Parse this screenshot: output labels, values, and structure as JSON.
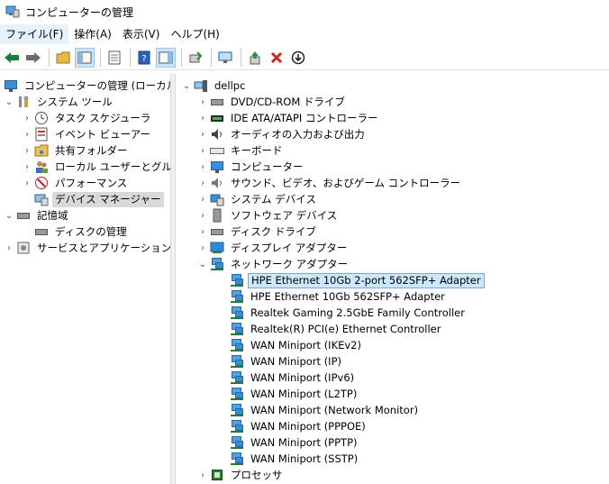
{
  "window": {
    "title": "コンピューターの管理"
  },
  "menu": [
    {
      "label": "ファイル(F)"
    },
    {
      "label": "操作(A)"
    },
    {
      "label": "表示(V)"
    },
    {
      "label": "ヘルプ(H)"
    }
  ],
  "left_tree": {
    "root": "コンピューターの管理 (ローカル)",
    "system_tools": "システム ツール",
    "task_scheduler": "タスク スケジューラ",
    "event_viewer": "イベント ビューアー",
    "shared_folders": "共有フォルダー",
    "local_users": "ローカル ユーザーとグループ",
    "performance": "パフォーマンス",
    "device_manager": "デバイス マネージャー",
    "storage": "記憶域",
    "disk_management": "ディスクの管理",
    "services_apps": "サービスとアプリケーション"
  },
  "device_tree": {
    "computer_name": "dellpc",
    "categories": {
      "dvd": "DVD/CD-ROM ドライブ",
      "ide": "IDE ATA/ATAPI コントローラー",
      "audio_io": "オーディオの入力および出力",
      "keyboard": "キーボード",
      "computer": "コンピューター",
      "sound": "サウンド、ビデオ、およびゲーム コントローラー",
      "system_devices": "システム デバイス",
      "software_devices": "ソフトウェア デバイス",
      "disk_drives": "ディスク ドライブ",
      "display_adapters": "ディスプレイ アダプター",
      "network_adapters": "ネットワーク アダプター",
      "processors": "プロセッサ"
    },
    "network_devices": [
      "HPE Ethernet 10Gb 2-port 562SFP+ Adapter",
      "HPE Ethernet 10Gb 562SFP+ Adapter",
      "Realtek Gaming 2.5GbE Family Controller",
      "Realtek(R) PCI(e) Ethernet Controller",
      "WAN Miniport (IKEv2)",
      "WAN Miniport (IP)",
      "WAN Miniport (IPv6)",
      "WAN Miniport (L2TP)",
      "WAN Miniport (Network Monitor)",
      "WAN Miniport (PPPOE)",
      "WAN Miniport (PPTP)",
      "WAN Miniport (SSTP)"
    ]
  },
  "colors": {
    "selection_blue": "#cce8ff",
    "selection_gray": "#d9d9d9",
    "accent": "#3a8fd6"
  }
}
